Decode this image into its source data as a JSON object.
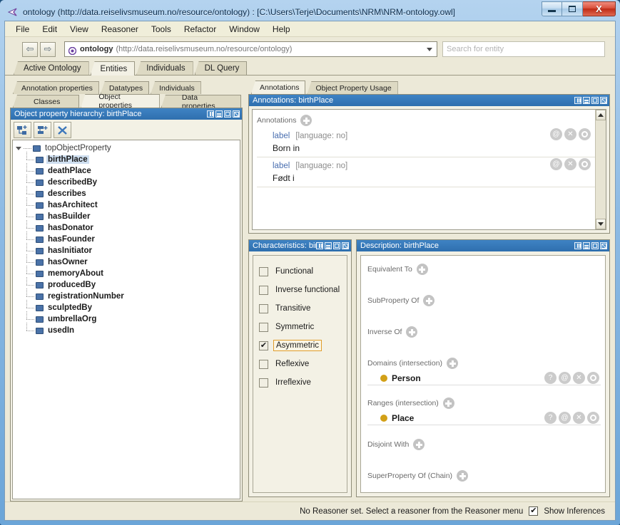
{
  "window": {
    "title": "ontology (http://data.reiselivsmuseum.no/resource/ontology)  : [C:\\Users\\Terje\\Documents\\NRM\\NRM-ontology.owl]",
    "app_icon": "protege-icon",
    "minimize_label": "Minimize",
    "maximize_label": "Maximize",
    "close_label": "X"
  },
  "menubar": {
    "items": [
      "File",
      "Edit",
      "View",
      "Reasoner",
      "Tools",
      "Refactor",
      "Window",
      "Help"
    ]
  },
  "toolbar": {
    "back_label": "⇦",
    "forward_label": "⇨",
    "ontology_name": "ontology",
    "ontology_iri": "(http://data.reiselivsmuseum.no/resource/ontology)",
    "search_placeholder": "Search for entity",
    "search_value": ""
  },
  "main_tabs": [
    {
      "label": "Active Ontology",
      "active": false
    },
    {
      "label": "Entities",
      "active": true
    },
    {
      "label": "Individuals",
      "active": false
    },
    {
      "label": "DL Query",
      "active": false
    }
  ],
  "entity_tabs_row1": [
    {
      "label": "Annotation properties",
      "active": false
    },
    {
      "label": "Datatypes",
      "active": false
    },
    {
      "label": "Individuals",
      "active": false
    }
  ],
  "entity_tabs_row2": [
    {
      "label": "Classes",
      "active": false
    },
    {
      "label": "Object properties",
      "active": true
    },
    {
      "label": "Data properties",
      "active": false
    }
  ],
  "hierarchy_panel": {
    "title": "Object property hierarchy: birthPlace",
    "toolbar_buttons": [
      "add-sub-property-icon",
      "add-sibling-property-icon",
      "delete-property-icon"
    ],
    "root": "topObjectProperty",
    "items": [
      {
        "label": "birthPlace",
        "selected": true
      },
      {
        "label": "deathPlace",
        "selected": false
      },
      {
        "label": "describedBy",
        "selected": false
      },
      {
        "label": "describes",
        "selected": false
      },
      {
        "label": "hasArchitect",
        "selected": false
      },
      {
        "label": "hasBuilder",
        "selected": false
      },
      {
        "label": "hasDonator",
        "selected": false
      },
      {
        "label": "hasFounder",
        "selected": false
      },
      {
        "label": "hasInitiator",
        "selected": false
      },
      {
        "label": "hasOwner",
        "selected": false
      },
      {
        "label": "memoryAbout",
        "selected": false
      },
      {
        "label": "producedBy",
        "selected": false
      },
      {
        "label": "registrationNumber",
        "selected": false
      },
      {
        "label": "sculptedBy",
        "selected": false
      },
      {
        "label": "umbrellaOrg",
        "selected": false
      },
      {
        "label": "usedIn",
        "selected": false
      }
    ]
  },
  "right_tabs": [
    {
      "label": "Annotations",
      "active": true
    },
    {
      "label": "Object Property Usage",
      "active": false
    }
  ],
  "annotations_panel": {
    "title": "Annotations: birthPlace",
    "section_label": "Annotations",
    "add_label": "+",
    "rows": [
      {
        "key": "label",
        "lang": "[language: no]",
        "value": "Born in"
      },
      {
        "key": "label",
        "lang": "[language: no]",
        "value": "Født i"
      }
    ],
    "row_icons": [
      "at-icon",
      "delete-icon",
      "edit-icon"
    ]
  },
  "characteristics_panel": {
    "title": "Characteristics: bir",
    "items": [
      {
        "label": "Functional",
        "checked": false,
        "focused": false
      },
      {
        "label": "Inverse functional",
        "checked": false,
        "focused": false
      },
      {
        "label": "Transitive",
        "checked": false,
        "focused": false
      },
      {
        "label": "Symmetric",
        "checked": false,
        "focused": false
      },
      {
        "label": "Asymmetric",
        "checked": true,
        "focused": true
      },
      {
        "label": "Reflexive",
        "checked": false,
        "focused": false
      },
      {
        "label": "Irreflexive",
        "checked": false,
        "focused": false
      }
    ],
    "check_glyph": "✔"
  },
  "description_panel": {
    "title": "Description: birthPlace",
    "sections": [
      {
        "label": "Equivalent To",
        "items": []
      },
      {
        "label": "SubProperty Of",
        "items": []
      },
      {
        "label": "Inverse Of",
        "items": []
      },
      {
        "label": "Domains (intersection)",
        "items": [
          {
            "name": "Person"
          }
        ]
      },
      {
        "label": "Ranges (intersection)",
        "items": [
          {
            "name": "Place"
          }
        ]
      },
      {
        "label": "Disjoint With",
        "items": []
      },
      {
        "label": "SuperProperty Of (Chain)",
        "items": []
      }
    ],
    "item_icons": [
      "help-icon",
      "at-icon",
      "delete-icon",
      "edit-icon"
    ]
  },
  "statusbar": {
    "message": "No Reasoner set. Select a reasoner from the Reasoner menu",
    "show_inferences_label": "Show Inferences",
    "show_inferences_checked": true,
    "check_glyph": "✔"
  },
  "colors": {
    "panel_title": "#2f6fae",
    "entity_dot": "#d2a017",
    "tree_icon": "#4a72a8",
    "focus_border": "#e09c2a",
    "annotation_key": "#4a6fb0"
  }
}
